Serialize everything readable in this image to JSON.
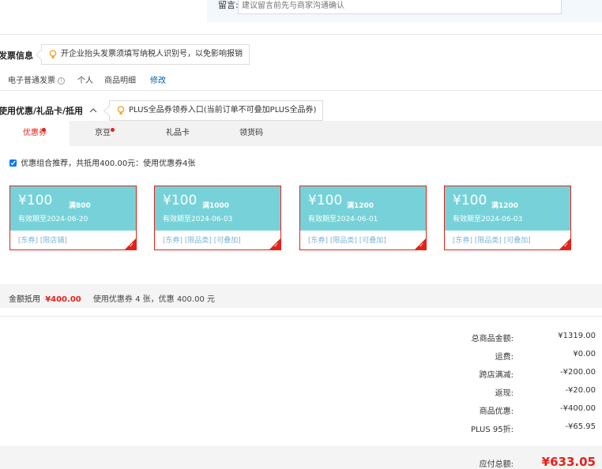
{
  "remark": {
    "label": "留言:",
    "placeholder": "建议留言前先与商家沟通确认"
  },
  "invoice": {
    "title": "发票信息",
    "tip": "开企业抬头发票须填写纳税人识别号，以免影响报销",
    "type": "电子普通发票",
    "holder": "个人",
    "content": "商品明细",
    "edit_label": "修改"
  },
  "discount": {
    "title": "使用优惠/礼品卡/抵用",
    "tip": "PLUS全品券领券入口(当前订单不可叠加PLUS全品券)",
    "tabs": [
      {
        "label": "优惠券",
        "has_dot": true,
        "active": true
      },
      {
        "label": "京豆",
        "has_dot": true,
        "active": false
      },
      {
        "label": "礼品卡",
        "has_dot": false,
        "active": false
      },
      {
        "label": "领货码",
        "has_dot": false,
        "active": false
      }
    ],
    "combo_checked": true,
    "combo_label": "优惠组合推荐，共抵用400.00元：使用优惠券4张",
    "coupons": [
      {
        "amount": "¥100",
        "condition": "满800",
        "validity": "有效期至2024-06-20",
        "tags": "[东券] [限店铺]",
        "selected": true
      },
      {
        "amount": "¥100",
        "condition": "满1000",
        "validity": "有效期至2024-06-03",
        "tags": "[东券] [限品类] [可叠加]",
        "selected": true
      },
      {
        "amount": "¥100",
        "condition": "满1200",
        "validity": "有效期至2024-06-01",
        "tags": "[东券] [限品类] [可叠加]",
        "selected": true
      },
      {
        "amount": "¥100",
        "condition": "满1200",
        "validity": "有效期至2024-06-03",
        "tags": "[东券] [限品类] [可叠加]",
        "selected": true
      }
    ],
    "deduct_label": "金额抵用",
    "deduct_value": "¥400.00",
    "deduct_desc": "使用优惠券 4 张，优惠 400.00 元"
  },
  "summary": [
    {
      "label": "总商品金额:",
      "value": "¥1319.00"
    },
    {
      "label": "运费:",
      "value": "¥0.00"
    },
    {
      "label": "跨店满减:",
      "value": "-¥200.00"
    },
    {
      "label": "返现:",
      "value": "-¥20.00"
    },
    {
      "label": "商品优惠:",
      "value": "-¥400.00"
    },
    {
      "label": "PLUS 95折:",
      "value": "-¥65.95"
    }
  ],
  "total": {
    "label": "应付总额:",
    "value": "¥633.05"
  },
  "colors": {
    "accent": "#e2231a",
    "coupon_bg": "#76d2d8",
    "link": "#005ea7"
  }
}
